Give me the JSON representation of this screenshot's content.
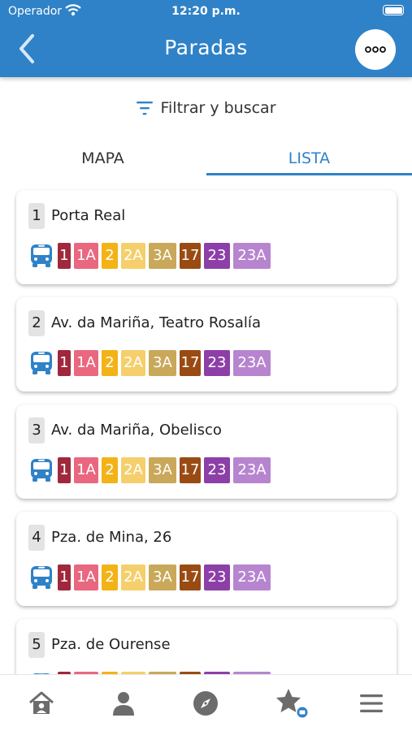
{
  "status_bar": {
    "carrier": "Operador",
    "time": "12:20 p.m."
  },
  "header": {
    "title": "Paradas"
  },
  "filter": {
    "label": "Filtrar y buscar"
  },
  "tabs": [
    {
      "label": "MAPA",
      "active": false
    },
    {
      "label": "LISTA",
      "active": true
    }
  ],
  "lines": [
    {
      "label": "1",
      "color": "#a0283c"
    },
    {
      "label": "1A",
      "color": "#e9677f"
    },
    {
      "label": "2",
      "color": "#f3b316"
    },
    {
      "label": "2A",
      "color": "#f5cf6b"
    },
    {
      "label": "3A",
      "color": "#c9a85a"
    },
    {
      "label": "17",
      "color": "#9a4b13"
    },
    {
      "label": "23",
      "color": "#8d3fa8"
    },
    {
      "label": "23A",
      "color": "#b785cf"
    }
  ],
  "stops": [
    {
      "number": "1",
      "name": "Porta Real"
    },
    {
      "number": "2",
      "name": "Av. da Mariña, Teatro Rosalía"
    },
    {
      "number": "3",
      "name": "Av. da Mariña, Obelisco"
    },
    {
      "number": "4",
      "name": "Pza. de Mina, 26"
    },
    {
      "number": "5",
      "name": "Pza. de Ourense"
    }
  ],
  "colors": {
    "header": "#2f82c7",
    "accent": "#2f82c7",
    "bus_icon": "#2f82c7"
  },
  "bottom_bar": [
    "home-icon",
    "user-icon",
    "compass-icon",
    "favorites-icon",
    "menu-icon"
  ]
}
